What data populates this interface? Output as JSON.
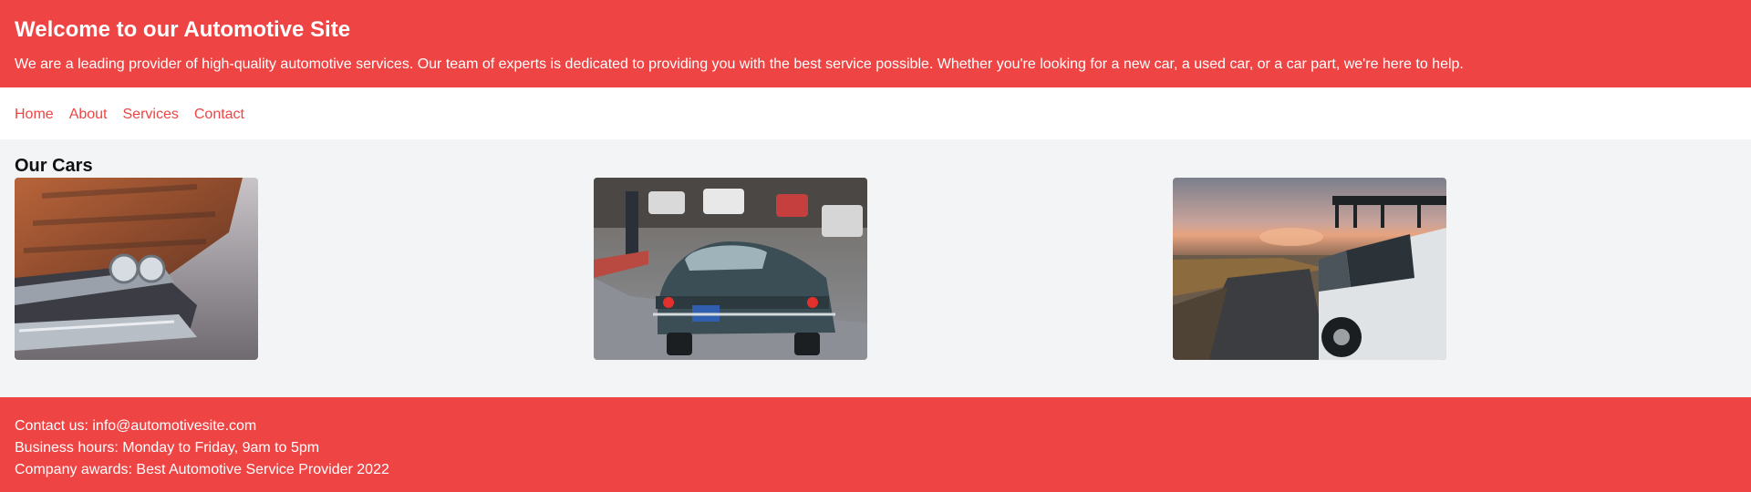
{
  "header": {
    "title": "Welcome to our Automotive Site",
    "intro": "We are a leading provider of high-quality automotive services. Our team of experts is dedicated to providing you with the best service possible. Whether you're looking for a new car, a used car, or a car part, we're here to help."
  },
  "nav": {
    "items": [
      {
        "label": "Home"
      },
      {
        "label": "About"
      },
      {
        "label": "Services"
      },
      {
        "label": "Contact"
      }
    ]
  },
  "cars": {
    "heading": "Our Cars",
    "photos": [
      "rusty-classic-car-photo",
      "vintage-sports-car-rear-photo",
      "offroad-suv-photo"
    ]
  },
  "footer": {
    "contact": "Contact us: info@automotivesite.com",
    "hours": "Business hours: Monday to Friday, 9am to 5pm",
    "awards": "Company awards: Best Automotive Service Provider 2022"
  },
  "colors": {
    "brand": "#ef4444",
    "page_bg": "#f3f4f6",
    "nav_bg": "#ffffff"
  }
}
